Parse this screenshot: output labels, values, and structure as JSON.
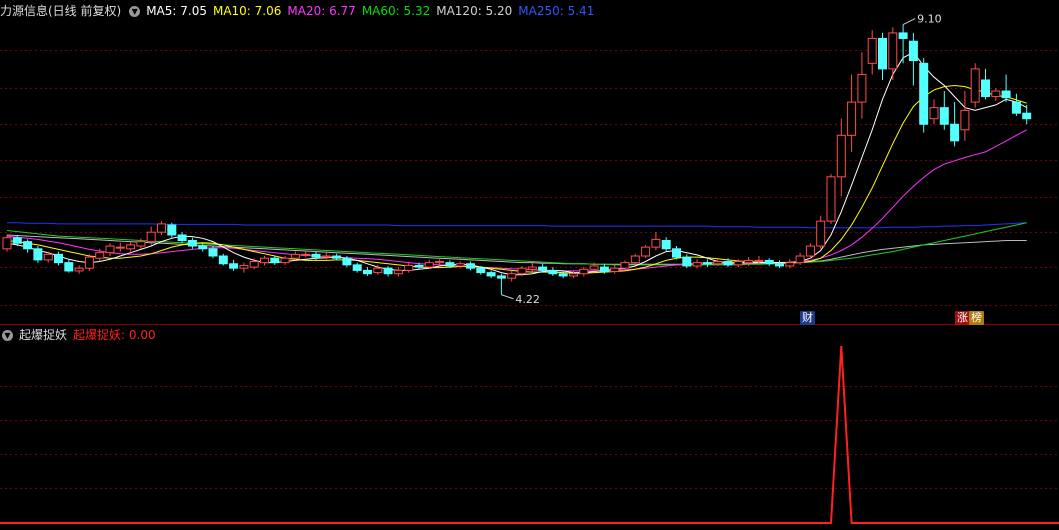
{
  "header": {
    "stock_title": "力源信息(日线 前复权)",
    "ma": [
      {
        "label": "MA5: 7.05",
        "color": "#ffffff"
      },
      {
        "label": "MA10: 7.06",
        "color": "#ffff00"
      },
      {
        "label": "MA20: 6.77",
        "color": "#ff33ff"
      },
      {
        "label": "MA60: 5.32",
        "color": "#00e000"
      },
      {
        "label": "MA120: 5.20",
        "color": "#d0d0d0"
      },
      {
        "label": "MA250: 5.41",
        "color": "#3355ff"
      }
    ]
  },
  "sub": {
    "title": "起爆捉妖",
    "value_label": "起爆捉妖: 0.00",
    "color": "#ff2020"
  },
  "markers": {
    "high_label": "9.10",
    "low_label": "4.22",
    "tag_cai": "财",
    "tag_zhang": "涨",
    "tag_bang": "榜"
  },
  "colors": {
    "up": "#ff4d4d",
    "down": "#54ffff",
    "grid": "#7a0000",
    "ma250": "#2233ff"
  },
  "chart_data": {
    "type": "candlestick",
    "price_range": [
      3.8,
      9.4
    ],
    "high": 9.1,
    "low": 4.22,
    "candles": [
      [
        5.05,
        5.25,
        5.0,
        5.3
      ],
      [
        5.25,
        5.15,
        5.1,
        5.3
      ],
      [
        5.18,
        5.05,
        4.98,
        5.22
      ],
      [
        5.05,
        4.85,
        4.8,
        5.1
      ],
      [
        4.85,
        4.95,
        4.8,
        5.0
      ],
      [
        4.95,
        4.8,
        4.75,
        5.0
      ],
      [
        4.8,
        4.65,
        4.62,
        4.85
      ],
      [
        4.65,
        4.7,
        4.6,
        4.75
      ],
      [
        4.7,
        4.9,
        4.65,
        4.95
      ],
      [
        4.88,
        4.98,
        4.82,
        5.05
      ],
      [
        4.98,
        5.1,
        4.92,
        5.15
      ],
      [
        5.08,
        5.08,
        5.0,
        5.16
      ],
      [
        5.05,
        5.12,
        5.0,
        5.18
      ],
      [
        5.1,
        5.18,
        5.05,
        5.24
      ],
      [
        5.18,
        5.35,
        5.12,
        5.45
      ],
      [
        5.35,
        5.5,
        5.3,
        5.55
      ],
      [
        5.48,
        5.3,
        5.25,
        5.52
      ],
      [
        5.3,
        5.2,
        5.15,
        5.35
      ],
      [
        5.2,
        5.1,
        5.05,
        5.25
      ],
      [
        5.1,
        5.05,
        5.0,
        5.15
      ],
      [
        5.05,
        4.92,
        4.88,
        5.1
      ],
      [
        4.92,
        4.78,
        4.75,
        4.96
      ],
      [
        4.78,
        4.7,
        4.65,
        4.85
      ],
      [
        4.7,
        4.75,
        4.62,
        4.8
      ],
      [
        4.72,
        4.82,
        4.68,
        4.88
      ],
      [
        4.8,
        4.88,
        4.75,
        4.92
      ],
      [
        4.88,
        4.8,
        4.76,
        4.92
      ],
      [
        4.8,
        4.88,
        4.76,
        4.92
      ],
      [
        4.88,
        4.95,
        4.84,
        5.0
      ],
      [
        4.95,
        4.95,
        4.9,
        5.0
      ],
      [
        4.95,
        4.9,
        4.85,
        5.0
      ],
      [
        4.9,
        4.92,
        4.86,
        4.98
      ],
      [
        4.92,
        4.88,
        4.84,
        4.96
      ],
      [
        4.88,
        4.76,
        4.72,
        4.92
      ],
      [
        4.76,
        4.66,
        4.62,
        4.8
      ],
      [
        4.66,
        4.6,
        4.56,
        4.72
      ],
      [
        4.62,
        4.7,
        4.58,
        4.76
      ],
      [
        4.7,
        4.6,
        4.55,
        4.74
      ],
      [
        4.6,
        4.66,
        4.55,
        4.72
      ],
      [
        4.66,
        4.75,
        4.62,
        4.8
      ],
      [
        4.75,
        4.72,
        4.68,
        4.8
      ],
      [
        4.72,
        4.8,
        4.68,
        4.85
      ],
      [
        4.8,
        4.82,
        4.76,
        4.86
      ],
      [
        4.8,
        4.74,
        4.7,
        4.84
      ],
      [
        4.74,
        4.78,
        4.7,
        4.82
      ],
      [
        4.78,
        4.7,
        4.66,
        4.82
      ],
      [
        4.7,
        4.62,
        4.58,
        4.74
      ],
      [
        4.62,
        4.56,
        4.52,
        4.66
      ],
      [
        4.56,
        4.52,
        4.22,
        4.6
      ],
      [
        4.52,
        4.6,
        4.46,
        4.66
      ],
      [
        4.6,
        4.7,
        4.56,
        4.74
      ],
      [
        4.68,
        4.72,
        4.64,
        4.8
      ],
      [
        4.72,
        4.66,
        4.62,
        4.78
      ],
      [
        4.66,
        4.6,
        4.56,
        4.72
      ],
      [
        4.6,
        4.56,
        4.52,
        4.66
      ],
      [
        4.56,
        4.6,
        4.52,
        4.66
      ],
      [
        4.6,
        4.68,
        4.55,
        4.72
      ],
      [
        4.68,
        4.74,
        4.64,
        4.8
      ],
      [
        4.72,
        4.64,
        4.6,
        4.78
      ],
      [
        4.64,
        4.7,
        4.6,
        4.76
      ],
      [
        4.7,
        4.8,
        4.66,
        4.84
      ],
      [
        4.8,
        4.92,
        4.76,
        4.96
      ],
      [
        4.92,
        5.08,
        4.88,
        5.12
      ],
      [
        5.08,
        5.22,
        5.02,
        5.35
      ],
      [
        5.2,
        5.05,
        5.0,
        5.26
      ],
      [
        5.05,
        4.9,
        4.86,
        5.1
      ],
      [
        4.9,
        4.74,
        4.7,
        4.95
      ],
      [
        4.74,
        4.8,
        4.7,
        4.86
      ],
      [
        4.8,
        4.78,
        4.72,
        4.86
      ],
      [
        4.78,
        4.82,
        4.74,
        4.86
      ],
      [
        4.82,
        4.76,
        4.72,
        4.88
      ],
      [
        4.76,
        4.82,
        4.72,
        4.86
      ],
      [
        4.8,
        4.84,
        4.74,
        4.9
      ],
      [
        4.84,
        4.84,
        4.78,
        4.92
      ],
      [
        4.84,
        4.78,
        4.74,
        4.88
      ],
      [
        4.78,
        4.74,
        4.7,
        4.84
      ],
      [
        4.74,
        4.8,
        4.7,
        4.86
      ],
      [
        4.8,
        4.92,
        4.76,
        4.98
      ],
      [
        4.92,
        5.1,
        4.88,
        5.15
      ],
      [
        5.1,
        5.55,
        5.05,
        5.65
      ],
      [
        5.55,
        6.35,
        5.5,
        6.4
      ],
      [
        6.35,
        7.1,
        6.0,
        7.4
      ],
      [
        7.1,
        7.7,
        6.8,
        8.2
      ],
      [
        7.7,
        8.2,
        7.4,
        8.6
      ],
      [
        8.4,
        8.85,
        8.2,
        9.0
      ],
      [
        8.85,
        8.3,
        8.1,
        8.95
      ],
      [
        8.3,
        8.95,
        8.1,
        9.05
      ],
      [
        8.95,
        8.85,
        8.4,
        9.1
      ],
      [
        8.8,
        8.45,
        8.0,
        8.95
      ],
      [
        8.4,
        7.3,
        7.15,
        8.5
      ],
      [
        7.4,
        7.6,
        7.3,
        7.75
      ],
      [
        7.6,
        7.3,
        7.2,
        7.9
      ],
      [
        7.3,
        7.0,
        6.9,
        7.7
      ],
      [
        7.2,
        7.55,
        7.0,
        7.9
      ],
      [
        7.7,
        8.3,
        7.6,
        8.4
      ],
      [
        8.1,
        7.8,
        7.75,
        8.3
      ],
      [
        7.8,
        7.9,
        7.72,
        7.95
      ],
      [
        7.9,
        7.78,
        7.7,
        8.2
      ],
      [
        7.7,
        7.5,
        7.45,
        7.85
      ],
      [
        7.5,
        7.4,
        7.3,
        7.65
      ]
    ],
    "ma5": [
      5.15,
      5.12,
      5.08,
      5.02,
      4.98,
      4.92,
      4.86,
      4.82,
      4.8,
      4.82,
      4.86,
      4.92,
      4.98,
      5.04,
      5.1,
      5.18,
      5.24,
      5.28,
      5.27,
      5.24,
      5.18,
      5.08,
      4.98,
      4.9,
      4.84,
      4.8,
      4.8,
      4.82,
      4.84,
      4.86,
      4.88,
      4.89,
      4.9,
      4.88,
      4.84,
      4.78,
      4.72,
      4.68,
      4.66,
      4.66,
      4.68,
      4.7,
      4.74,
      4.76,
      4.77,
      4.76,
      4.72,
      4.68,
      4.62,
      4.58,
      4.58,
      4.6,
      4.64,
      4.66,
      4.65,
      4.62,
      4.62,
      4.64,
      4.66,
      4.68,
      4.7,
      4.74,
      4.82,
      4.92,
      5.0,
      5.02,
      4.98,
      4.94,
      4.88,
      4.82,
      4.8,
      4.8,
      4.8,
      4.8,
      4.8,
      4.8,
      4.8,
      4.82,
      4.88,
      5.02,
      5.3,
      5.72,
      6.2,
      6.7,
      7.2,
      7.75,
      8.2,
      8.5,
      8.6,
      8.35,
      8.15,
      8.0,
      7.8,
      7.6,
      7.55,
      7.6,
      7.65,
      7.75,
      7.7,
      7.6
    ],
    "ma10": [
      5.2,
      5.18,
      5.15,
      5.12,
      5.08,
      5.04,
      5.0,
      4.96,
      4.92,
      4.9,
      4.88,
      4.88,
      4.9,
      4.92,
      4.96,
      5.02,
      5.08,
      5.12,
      5.15,
      5.16,
      5.15,
      5.12,
      5.08,
      5.04,
      5.0,
      4.96,
      4.92,
      4.88,
      4.86,
      4.84,
      4.84,
      4.84,
      4.85,
      4.85,
      4.84,
      4.82,
      4.8,
      4.78,
      4.76,
      4.74,
      4.72,
      4.71,
      4.71,
      4.72,
      4.73,
      4.73,
      4.72,
      4.7,
      4.68,
      4.66,
      4.64,
      4.63,
      4.63,
      4.63,
      4.62,
      4.61,
      4.61,
      4.62,
      4.63,
      4.64,
      4.65,
      4.68,
      4.72,
      4.78,
      4.84,
      4.88,
      4.9,
      4.9,
      4.89,
      4.87,
      4.85,
      4.83,
      4.82,
      4.81,
      4.8,
      4.8,
      4.8,
      4.8,
      4.82,
      4.88,
      5.02,
      5.22,
      5.48,
      5.8,
      6.15,
      6.55,
      6.95,
      7.32,
      7.62,
      7.8,
      7.92,
      7.98,
      8.0,
      7.98,
      7.92,
      7.88,
      7.82,
      7.8,
      7.74,
      7.68
    ],
    "ma20": [
      5.28,
      5.26,
      5.24,
      5.22,
      5.19,
      5.16,
      5.12,
      5.08,
      5.04,
      5.01,
      4.98,
      4.96,
      4.95,
      4.95,
      4.96,
      4.98,
      5.0,
      5.02,
      5.04,
      5.06,
      5.07,
      5.07,
      5.06,
      5.04,
      5.02,
      5.0,
      4.98,
      4.96,
      4.94,
      4.93,
      4.92,
      4.91,
      4.9,
      4.89,
      4.88,
      4.87,
      4.86,
      4.84,
      4.82,
      4.8,
      4.78,
      4.77,
      4.76,
      4.75,
      4.74,
      4.73,
      4.72,
      4.71,
      4.7,
      4.69,
      4.68,
      4.67,
      4.66,
      4.66,
      4.65,
      4.65,
      4.65,
      4.65,
      4.65,
      4.66,
      4.67,
      4.68,
      4.7,
      4.72,
      4.74,
      4.76,
      4.78,
      4.79,
      4.8,
      4.8,
      4.8,
      4.8,
      4.8,
      4.8,
      4.8,
      4.8,
      4.81,
      4.82,
      4.84,
      4.88,
      4.94,
      5.02,
      5.12,
      5.26,
      5.42,
      5.6,
      5.8,
      6.0,
      6.18,
      6.34,
      6.48,
      6.58,
      6.64,
      6.7,
      6.75,
      6.8,
      6.9,
      7.0,
      7.1,
      7.2
    ],
    "ma60": [
      5.38,
      5.36,
      5.34,
      5.32,
      5.3,
      5.28,
      5.27,
      5.26,
      5.25,
      5.24,
      5.23,
      5.22,
      5.21,
      5.2,
      5.19,
      5.18,
      5.17,
      5.16,
      5.15,
      5.14,
      5.13,
      5.12,
      5.11,
      5.1,
      5.09,
      5.08,
      5.07,
      5.06,
      5.05,
      5.04,
      5.03,
      5.02,
      5.01,
      5.0,
      4.99,
      4.98,
      4.97,
      4.96,
      4.95,
      4.94,
      4.93,
      4.92,
      4.91,
      4.9,
      4.89,
      4.88,
      4.87,
      4.86,
      4.85,
      4.84,
      4.83,
      4.82,
      4.81,
      4.8,
      4.79,
      4.78,
      4.78,
      4.77,
      4.77,
      4.76,
      4.76,
      4.76,
      4.76,
      4.76,
      4.76,
      4.76,
      4.76,
      4.76,
      4.76,
      4.76,
      4.76,
      4.76,
      4.77,
      4.77,
      4.78,
      4.78,
      4.79,
      4.8,
      4.81,
      4.82,
      4.84,
      4.86,
      4.88,
      4.91,
      4.94,
      4.97,
      5.0,
      5.04,
      5.08,
      5.12,
      5.16,
      5.2,
      5.24,
      5.28,
      5.32,
      5.36,
      5.4,
      5.44,
      5.48,
      5.52
    ],
    "ma120": [
      5.3,
      5.29,
      5.28,
      5.27,
      5.26,
      5.25,
      5.24,
      5.23,
      5.22,
      5.21,
      5.2,
      5.19,
      5.18,
      5.17,
      5.16,
      5.15,
      5.14,
      5.13,
      5.12,
      5.11,
      5.1,
      5.09,
      5.08,
      5.07,
      5.06,
      5.05,
      5.04,
      5.03,
      5.02,
      5.01,
      5.0,
      4.99,
      4.98,
      4.97,
      4.96,
      4.95,
      4.94,
      4.93,
      4.92,
      4.91,
      4.9,
      4.89,
      4.88,
      4.87,
      4.86,
      4.85,
      4.84,
      4.83,
      4.82,
      4.81,
      4.8,
      4.8,
      4.79,
      4.79,
      4.78,
      4.78,
      4.78,
      4.77,
      4.77,
      4.77,
      4.77,
      4.77,
      4.77,
      4.77,
      4.77,
      4.77,
      4.77,
      4.77,
      4.77,
      4.78,
      4.78,
      4.78,
      4.78,
      4.79,
      4.79,
      4.8,
      4.8,
      4.81,
      4.82,
      4.83,
      4.86,
      4.9,
      4.94,
      4.98,
      5.01,
      5.04,
      5.06,
      5.08,
      5.1,
      5.12,
      5.13,
      5.14,
      5.15,
      5.16,
      5.17,
      5.18,
      5.19,
      5.2,
      5.2,
      5.2
    ],
    "ma250": [
      5.52,
      5.52,
      5.51,
      5.51,
      5.51,
      5.5,
      5.5,
      5.5,
      5.5,
      5.5,
      5.5,
      5.5,
      5.5,
      5.5,
      5.5,
      5.49,
      5.49,
      5.49,
      5.49,
      5.49,
      5.49,
      5.49,
      5.49,
      5.48,
      5.48,
      5.48,
      5.48,
      5.48,
      5.48,
      5.48,
      5.48,
      5.48,
      5.48,
      5.48,
      5.48,
      5.48,
      5.48,
      5.48,
      5.47,
      5.47,
      5.47,
      5.47,
      5.47,
      5.47,
      5.47,
      5.47,
      5.47,
      5.47,
      5.47,
      5.47,
      5.47,
      5.47,
      5.47,
      5.46,
      5.46,
      5.46,
      5.46,
      5.46,
      5.46,
      5.46,
      5.46,
      5.46,
      5.46,
      5.46,
      5.46,
      5.46,
      5.46,
      5.46,
      5.46,
      5.45,
      5.45,
      5.45,
      5.45,
      5.44,
      5.44,
      5.44,
      5.44,
      5.44,
      5.43,
      5.43,
      5.43,
      5.43,
      5.43,
      5.43,
      5.43,
      5.43,
      5.44,
      5.44,
      5.44,
      5.45,
      5.45,
      5.46,
      5.46,
      5.47,
      5.47,
      5.48,
      5.49,
      5.5,
      5.51,
      5.52
    ],
    "indicator_range": [
      0,
      1
    ],
    "indicator": [
      0,
      0,
      0,
      0,
      0,
      0,
      0,
      0,
      0,
      0,
      0,
      0,
      0,
      0,
      0,
      0,
      0,
      0,
      0,
      0,
      0,
      0,
      0,
      0,
      0,
      0,
      0,
      0,
      0,
      0,
      0,
      0,
      0,
      0,
      0,
      0,
      0,
      0,
      0,
      0,
      0,
      0,
      0,
      0,
      0,
      0,
      0,
      0,
      0,
      0,
      0,
      0,
      0,
      0,
      0,
      0,
      0,
      0,
      0,
      0,
      0,
      0,
      0,
      0,
      0,
      0,
      0,
      0,
      0,
      0,
      0,
      0,
      0,
      0,
      0,
      0,
      0,
      0,
      0,
      0,
      0,
      1,
      0,
      0,
      0,
      0,
      0,
      0,
      0,
      0,
      0,
      0,
      0,
      0,
      0,
      0,
      0,
      0,
      0,
      0
    ]
  }
}
